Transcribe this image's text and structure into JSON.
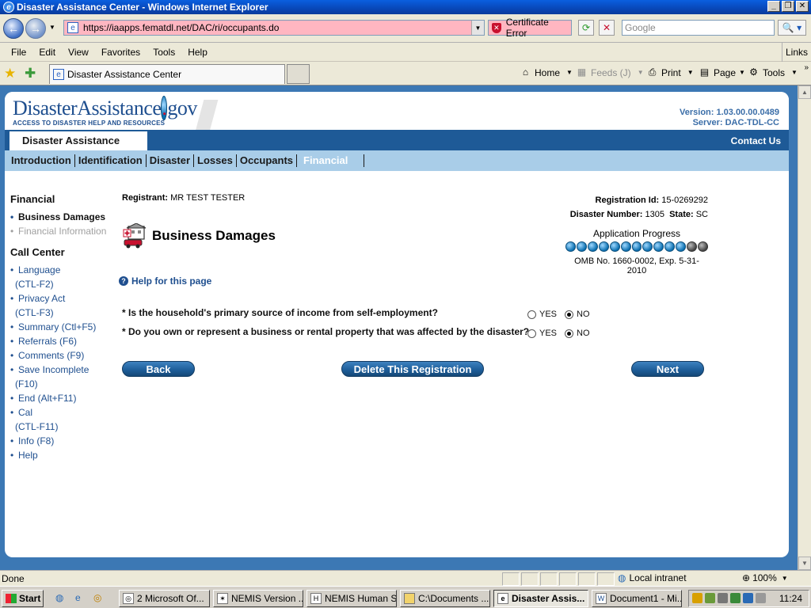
{
  "window": {
    "title": "Disaster Assistance Center - Windows Internet Explorer"
  },
  "addressbar": {
    "url": "https://iaapps.fematdl.net/DAC/ri/occupants.do",
    "cert_error": "Certificate Error",
    "search_placeholder": "Google"
  },
  "menubar": {
    "items": [
      "File",
      "Edit",
      "View",
      "Favorites",
      "Tools",
      "Help"
    ],
    "links": "Links"
  },
  "tabbar": {
    "tab_title": "Disaster Assistance Center",
    "commands": {
      "home": "Home",
      "feeds": "Feeds (J)",
      "print": "Print",
      "page": "Page",
      "tools": "Tools"
    }
  },
  "site": {
    "logo_main": "DisasterAssistance",
    "logo_dot": ".",
    "logo_tld": "gov",
    "logo_tagline": "ACCESS TO DISASTER HELP AND RESOURCES",
    "version": "Version: 1.03.00.00.0489",
    "server": "Server: DAC-TDL-CC",
    "section_title": "Disaster Assistance",
    "contact": "Contact Us",
    "tabs": [
      "Introduction",
      "Identification",
      "Disaster",
      "Losses",
      "Occupants",
      "Financial"
    ],
    "active_tab": "Financial"
  },
  "sidenav": {
    "financial_header": "Financial",
    "financial_items": [
      "Business Damages",
      "Financial Information"
    ],
    "callcenter_header": "Call Center",
    "callcenter": {
      "language": "Language",
      "language_key": "(CTL-F2)",
      "privacy": "Privacy Act",
      "privacy_key": "(CTL-F3)",
      "summary": "Summary (Ctl+F5)",
      "referrals": "Referrals (F6)",
      "comments": "Comments (F9)",
      "save": "Save Incomplete",
      "save_key": "(F10)",
      "end": "End (Alt+F11)",
      "cal": "Cal",
      "cal_key": "(CTL-F11)",
      "info": "Info (F8)",
      "help": "Help"
    }
  },
  "main": {
    "registrant_label": "Registrant:",
    "registrant_value": "MR TEST TESTER",
    "regid_label": "Registration Id:",
    "regid_value": "15-0269292",
    "disaster_label": "Disaster Number:",
    "disaster_value": "1305",
    "state_label": "State:",
    "state_value": "SC",
    "page_title": "Business Damages",
    "progress_label": "Application Progress",
    "progress": {
      "completed": 11,
      "total": 13
    },
    "omb": "OMB No. 1660-0002, Exp. 5-31-2010",
    "help_link": "Help for this page",
    "questions": [
      {
        "text": "* Is the household's primary source of income from self-employment?",
        "answer": "NO"
      },
      {
        "text": "* Do you own or represent a business or rental property that was affected by the disaster?",
        "answer": "NO"
      }
    ],
    "yes_label": "YES",
    "no_label": "NO",
    "buttons": {
      "back": "Back",
      "delete": "Delete This Registration",
      "next": "Next"
    }
  },
  "statusbar": {
    "status": "Done",
    "zone": "Local intranet",
    "zoom": "100%"
  },
  "taskbar": {
    "start": "Start",
    "tasks": [
      "2 Microsoft Of...",
      "NEMIS Version ...",
      "NEMIS Human S...",
      "C:\\Documents ...",
      "Disaster Assis...",
      "Document1 - Mi..."
    ],
    "clock": "11:24"
  }
}
